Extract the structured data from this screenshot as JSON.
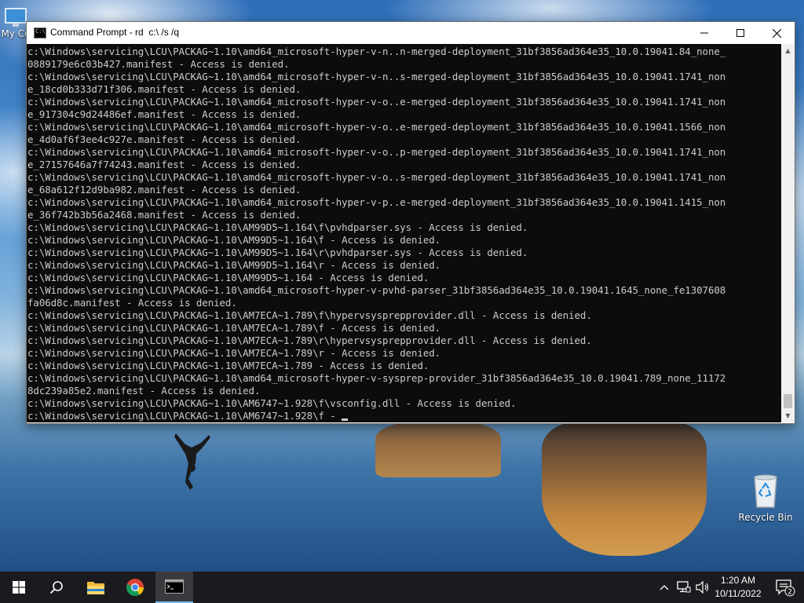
{
  "desktop": {
    "mycomputer_label": "My Co",
    "recycle_label": "Recycle Bin"
  },
  "window": {
    "title": "Command Prompt - rd  c:\\ /s /q",
    "console_lines": [
      "c:\\Windows\\servicing\\LCU\\PACKAG~1.10\\amd64_microsoft-hyper-v-n..n-merged-deployment_31bf3856ad364e35_10.0.19041.84_none_",
      "0889179e6c03b427.manifest - Access is denied.",
      "c:\\Windows\\servicing\\LCU\\PACKAG~1.10\\amd64_microsoft-hyper-v-n..s-merged-deployment_31bf3856ad364e35_10.0.19041.1741_non",
      "e_18cd0b333d71f306.manifest - Access is denied.",
      "c:\\Windows\\servicing\\LCU\\PACKAG~1.10\\amd64_microsoft-hyper-v-o..e-merged-deployment_31bf3856ad364e35_10.0.19041.1741_non",
      "e_917304c9d24486ef.manifest - Access is denied.",
      "c:\\Windows\\servicing\\LCU\\PACKAG~1.10\\amd64_microsoft-hyper-v-o..e-merged-deployment_31bf3856ad364e35_10.0.19041.1566_non",
      "e_4d0af6f3ee4c927e.manifest - Access is denied.",
      "c:\\Windows\\servicing\\LCU\\PACKAG~1.10\\amd64_microsoft-hyper-v-o..p-merged-deployment_31bf3856ad364e35_10.0.19041.1741_non",
      "e_27157646a7f74243.manifest - Access is denied.",
      "c:\\Windows\\servicing\\LCU\\PACKAG~1.10\\amd64_microsoft-hyper-v-o..s-merged-deployment_31bf3856ad364e35_10.0.19041.1741_non",
      "e_68a612f12d9ba982.manifest - Access is denied.",
      "c:\\Windows\\servicing\\LCU\\PACKAG~1.10\\amd64_microsoft-hyper-v-p..e-merged-deployment_31bf3856ad364e35_10.0.19041.1415_non",
      "e_36f742b3b56a2468.manifest - Access is denied.",
      "c:\\Windows\\servicing\\LCU\\PACKAG~1.10\\AM99D5~1.164\\f\\pvhdparser.sys - Access is denied.",
      "c:\\Windows\\servicing\\LCU\\PACKAG~1.10\\AM99D5~1.164\\f - Access is denied.",
      "c:\\Windows\\servicing\\LCU\\PACKAG~1.10\\AM99D5~1.164\\r\\pvhdparser.sys - Access is denied.",
      "c:\\Windows\\servicing\\LCU\\PACKAG~1.10\\AM99D5~1.164\\r - Access is denied.",
      "c:\\Windows\\servicing\\LCU\\PACKAG~1.10\\AM99D5~1.164 - Access is denied.",
      "c:\\Windows\\servicing\\LCU\\PACKAG~1.10\\amd64_microsoft-hyper-v-pvhd-parser_31bf3856ad364e35_10.0.19041.1645_none_fe1307608",
      "fa06d8c.manifest - Access is denied.",
      "c:\\Windows\\servicing\\LCU\\PACKAG~1.10\\AM7ECA~1.789\\f\\hypervsysprepprovider.dll - Access is denied.",
      "c:\\Windows\\servicing\\LCU\\PACKAG~1.10\\AM7ECA~1.789\\f - Access is denied.",
      "c:\\Windows\\servicing\\LCU\\PACKAG~1.10\\AM7ECA~1.789\\r\\hypervsysprepprovider.dll - Access is denied.",
      "c:\\Windows\\servicing\\LCU\\PACKAG~1.10\\AM7ECA~1.789\\r - Access is denied.",
      "c:\\Windows\\servicing\\LCU\\PACKAG~1.10\\AM7ECA~1.789 - Access is denied.",
      "c:\\Windows\\servicing\\LCU\\PACKAG~1.10\\amd64_microsoft-hyper-v-sysprep-provider_31bf3856ad364e35_10.0.19041.789_none_11172",
      "8dc239a85e2.manifest - Access is denied.",
      "c:\\Windows\\servicing\\LCU\\PACKAG~1.10\\AM6747~1.928\\f\\vsconfig.dll - Access is denied.",
      "c:\\Windows\\servicing\\LCU\\PACKAG~1.10\\AM6747~1.928\\f - "
    ]
  },
  "taskbar": {
    "time": "1:20 AM",
    "date": "10/11/2022",
    "notification_count": "2"
  },
  "colors": {
    "console_bg": "#0c0c0c",
    "console_text": "#cccccc",
    "taskbar_bg": "#1b1b1f",
    "active_indicator": "#76b9ed"
  }
}
